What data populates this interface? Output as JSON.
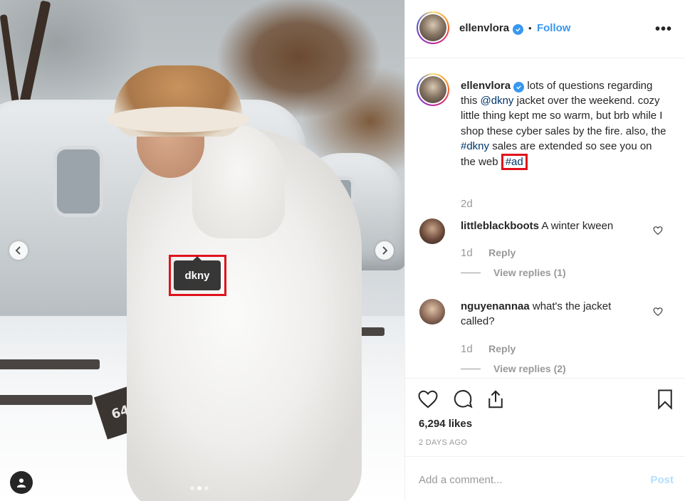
{
  "post": {
    "username": "ellenvlora",
    "follow_label": "Follow",
    "separator": "•",
    "more_label": "•••",
    "caption": {
      "part1": "lots of questions regarding this ",
      "mention": "@dkny",
      "part2": " jacket over the weekend. cozy little thing kept me so warm, but brb while I shop these cyber sales by the fire. also, the ",
      "hashtag1": "#dkny",
      "part3": " sales are extended so see you on the web ",
      "hashtag2": "#ad",
      "time": "2d"
    },
    "photo": {
      "product_tag": "dkny",
      "sign_text": "64",
      "carousel_count": 3,
      "carousel_active_index": 1
    }
  },
  "comments": [
    {
      "username": "littleblackboots",
      "text": "A winter kween",
      "time": "1d",
      "reply_label": "Reply",
      "view_replies": "View replies (1)"
    },
    {
      "username": "nguyenannaa",
      "text": "what's the jacket called?",
      "time": "1d",
      "reply_label": "Reply",
      "view_replies": "View replies (2)"
    }
  ],
  "footer": {
    "likes": "6,294 likes",
    "date": "2 DAYS AGO",
    "comment_placeholder": "Add a comment...",
    "post_label": "Post"
  },
  "colors": {
    "link": "#003569",
    "accent": "#3897f0",
    "highlight": "#e0121b",
    "muted": "#999999"
  }
}
